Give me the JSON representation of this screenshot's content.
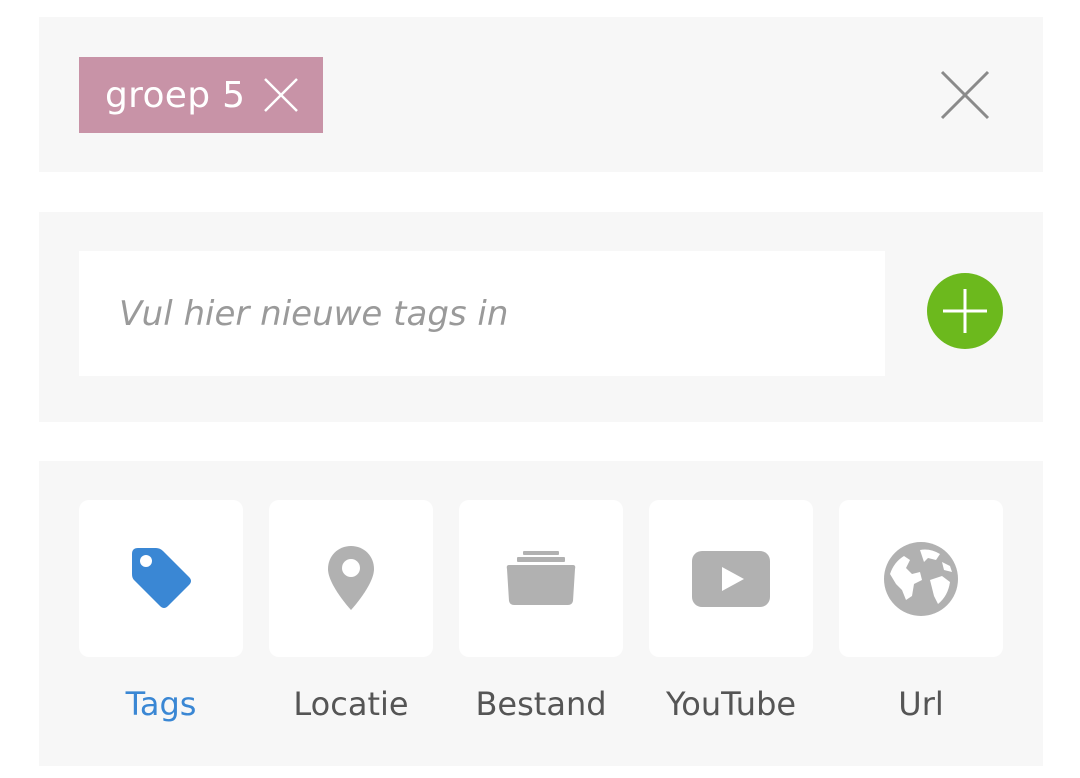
{
  "tags_panel": {
    "chip_label": "groep 5"
  },
  "input_panel": {
    "placeholder": "Vul hier nieuwe tags in",
    "value": ""
  },
  "types": {
    "items": [
      {
        "label": "Tags",
        "icon": "tag-icon",
        "active": true
      },
      {
        "label": "Locatie",
        "icon": "location-pin-icon",
        "active": false
      },
      {
        "label": "Bestand",
        "icon": "folder-icon",
        "active": false
      },
      {
        "label": "YouTube",
        "icon": "youtube-icon",
        "active": false
      },
      {
        "label": "Url",
        "icon": "globe-icon",
        "active": false
      }
    ]
  },
  "colors": {
    "chip_background": "#c893a7",
    "add_button": "#6cb91d",
    "active": "#3a87d4",
    "inactive_icon": "#b1b1b1",
    "panel_background": "#f7f7f7"
  }
}
